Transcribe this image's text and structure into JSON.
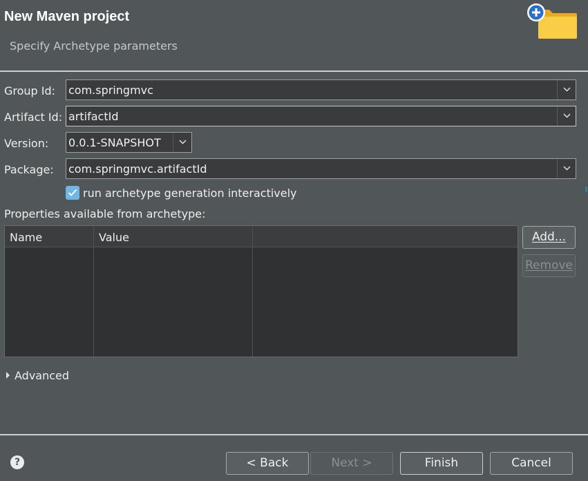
{
  "header": {
    "title": "New Maven project",
    "subtitle": "Specify Archetype parameters",
    "icon": "new-folder-plus-icon"
  },
  "form": {
    "group_id": {
      "label": "Group Id:",
      "value": "com.springmvc"
    },
    "artifact_id": {
      "label": "Artifact Id:",
      "value": "artifactId"
    },
    "version": {
      "label": "Version:",
      "value": "0.0.1-SNAPSHOT"
    },
    "package": {
      "label": "Package:",
      "value": "com.springmvc.artifactId"
    },
    "interactive": {
      "label": "run archetype generation interactively",
      "checked": true
    },
    "properties_label": "Properties available from archetype:"
  },
  "properties_table": {
    "columns": [
      "Name",
      "Value"
    ],
    "rows": []
  },
  "side_buttons": {
    "add": "Add...",
    "remove": "Remove"
  },
  "advanced": {
    "label": "Advanced"
  },
  "footer": {
    "back": "< Back",
    "next": "Next >",
    "finish": "Finish",
    "cancel": "Cancel"
  },
  "colors": {
    "background": "#515658",
    "field_bg": "#393b3d",
    "checkbox_accent": "#70b6e6",
    "icon_folder": "#f7c23c",
    "icon_badge": "#2a6fc9"
  }
}
